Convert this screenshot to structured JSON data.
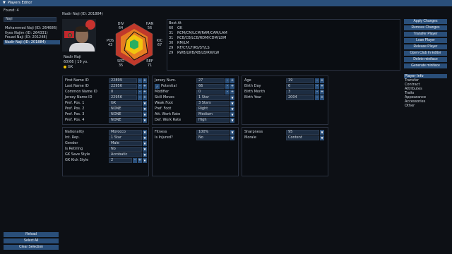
{
  "title": "Players Editor",
  "found": "Found: 4",
  "search": "Naji",
  "players": [
    "Mohammed Naji (ID: 264686)",
    "Ilyes Najim (ID: 264331)",
    "Fouad Naji (ID: 201248)",
    "Nadir Naji (ID: 201884)"
  ],
  "selected_player_index": 3,
  "left_buttons": [
    "Reload",
    "Select All",
    "Clear Selection"
  ],
  "header_name": "Nadir Naji (ID: 201884)",
  "card": {
    "name": "Nadir Naji",
    "info": "60/66 | 19 yo.",
    "position": "GK"
  },
  "radar": {
    "div": "DIV",
    "div_v": "64",
    "han": "HAN",
    "han_v": "56",
    "kic": "KIC",
    "kic_v": "67",
    "ref": "REF",
    "ref_v": "71",
    "spd": "SPD",
    "spd_v": "35",
    "pos": "POS",
    "pos_v": "43"
  },
  "best_at": {
    "title": "Best At",
    "rows": [
      {
        "r": "60",
        "p": "GK"
      },
      {
        "r": "31",
        "p": "RCM/CM/LCM/RAM/CAM/LAM"
      },
      {
        "r": "31",
        "p": "RCB/CB/LCB/RDM/CDM/LDM"
      },
      {
        "r": "30",
        "p": "RM/LM"
      },
      {
        "r": "29",
        "p": "RF/CF/LF/RS/ST/LS"
      },
      {
        "r": "29",
        "p": "RWB/LWB/RB/LB/RW/LW"
      }
    ]
  },
  "right_buttons": [
    "Apply Changes",
    "Remove Changes",
    "Transfer Player",
    "Loan Player",
    "Release Player",
    "Open Club In Editor",
    "Delete miniface",
    "Generate miniface"
  ],
  "tabs": [
    "Player Info",
    "Transfer",
    "Contract",
    "Attributes",
    "Traits",
    "Appearance",
    "Accessories",
    "Other"
  ],
  "ids": [
    {
      "label": "First Name ID",
      "value": "22899"
    },
    {
      "label": "Last Name ID",
      "value": "22956"
    },
    {
      "label": "Common Name ID",
      "value": "0"
    },
    {
      "label": "Jersey Name ID",
      "value": "22956"
    }
  ],
  "positions": [
    {
      "label": "Pref. Pos. 1",
      "value": "GK"
    },
    {
      "label": "Pref. Pos. 2",
      "value": "NONE"
    },
    {
      "label": "Pref. Pos. 3",
      "value": "NONE"
    },
    {
      "label": "Pref. Pos. 4",
      "value": "NONE"
    }
  ],
  "jersey": {
    "label": "Jersey Num.",
    "value": "27"
  },
  "potential": {
    "label": "Potential",
    "value": "66"
  },
  "modifier": {
    "label": "Modifier",
    "value": "0"
  },
  "skill": [
    {
      "label": "Skill Moves",
      "value": "1 Star"
    },
    {
      "label": "Weak Foot",
      "value": "3 Stars"
    },
    {
      "label": "Pref. Foot",
      "value": "Right"
    },
    {
      "label": "Att. Work Rate",
      "value": "Medium"
    },
    {
      "label": "Def. Work Rate",
      "value": "High"
    }
  ],
  "age_fields": [
    {
      "label": "Age",
      "value": "19"
    },
    {
      "label": "Birth Day",
      "value": "6"
    },
    {
      "label": "Birth Month",
      "value": "3"
    },
    {
      "label": "Birth Year",
      "value": "2004"
    }
  ],
  "misc": [
    {
      "label": "Nationality",
      "value": "Morocco"
    },
    {
      "label": "Int. Rep.",
      "value": "1 Star"
    },
    {
      "label": "Gender",
      "value": "Male"
    },
    {
      "label": "Is Retiring",
      "value": "No"
    },
    {
      "label": "GK Save Style",
      "value": "Acrobatic"
    },
    {
      "label": "GK Kick Style",
      "value": "2"
    }
  ],
  "fitness": {
    "label": "Fitness",
    "value": "100%"
  },
  "injured": {
    "label": "Is Injured?",
    "value": "No"
  },
  "sharpness": {
    "label": "Sharpness",
    "value": "95"
  },
  "morale": {
    "label": "Morale",
    "value": "Content"
  },
  "colors": {
    "accent": "#2a4f7a",
    "bg": "#0d1015"
  }
}
